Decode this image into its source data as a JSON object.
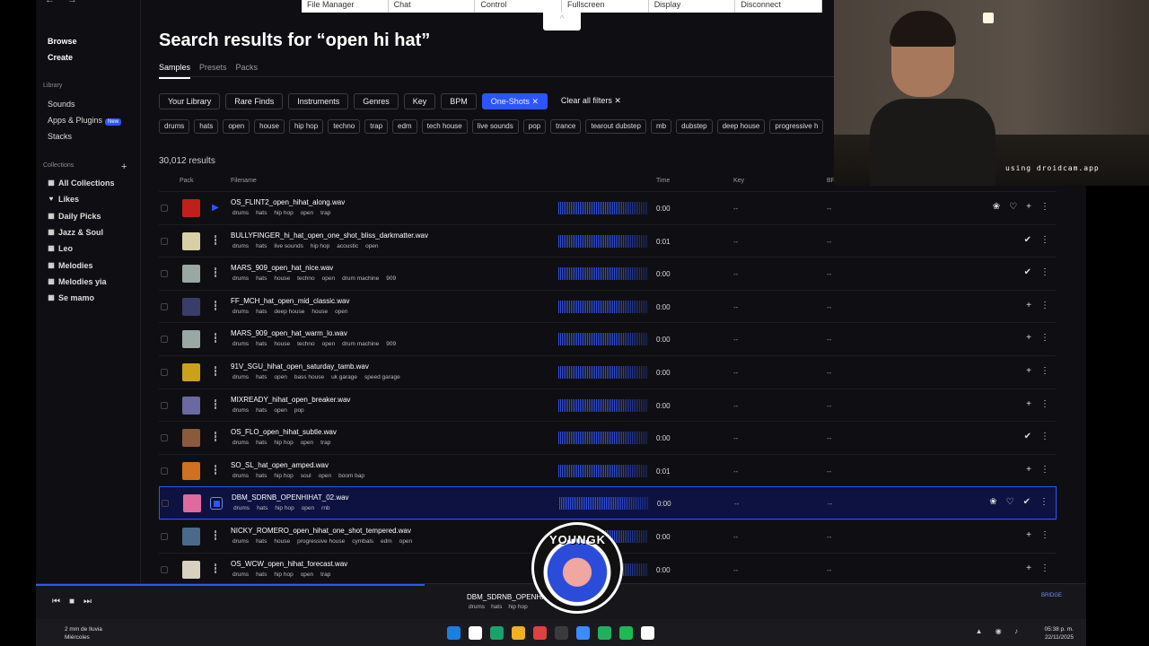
{
  "remote_bar": {
    "items": [
      "File Manager",
      "Chat",
      "Control",
      "Fullscreen",
      "Display",
      "Disconnect"
    ],
    "tab_glyph": "^"
  },
  "app": {
    "top_label": "Companion",
    "nav_main": [
      "Browse",
      "Create"
    ],
    "library_label": "Library",
    "nav_library": [
      {
        "label": "Sounds",
        "badge": ""
      },
      {
        "label": "Apps & Plugins",
        "badge": "New"
      },
      {
        "label": "Stacks",
        "badge": ""
      }
    ],
    "collections_label": "Collections",
    "add_collection": "+",
    "collections": [
      "All Collections",
      "Likes",
      "Daily Picks",
      "Jazz & Soul",
      "Leo",
      "Melodies",
      "Melodies yia",
      "Se mamo"
    ]
  },
  "search": {
    "title": "Search results for “open hi hat”",
    "tabs": [
      "Samples",
      "Presets",
      "Packs"
    ],
    "filters": [
      {
        "label": "Your Library",
        "style": "outline"
      },
      {
        "label": "Rare Finds",
        "style": "outline"
      },
      {
        "label": "Instruments",
        "style": "outline"
      },
      {
        "label": "Genres",
        "style": "outline"
      },
      {
        "label": "Key",
        "style": "outline"
      },
      {
        "label": "BPM",
        "style": "outline"
      },
      {
        "label": "One-Shots ✕",
        "style": "blue"
      },
      {
        "label": "Clear all filters ✕",
        "style": "plain"
      }
    ],
    "tag_chips": [
      "drums",
      "hats",
      "open",
      "house",
      "hip hop",
      "techno",
      "trap",
      "edm",
      "tech house",
      "live sounds",
      "pop",
      "trance",
      "tearout dubstep",
      "mb",
      "dubstep",
      "deep house",
      "progressive h"
    ],
    "results_count": "30,012 results",
    "columns": {
      "pack": "Pack",
      "filename": "Filename",
      "time": "Time",
      "key": "Key",
      "bpm": "BP"
    }
  },
  "rows": [
    {
      "file": "OS_FLINT2_open_hihat_along.wav",
      "tags": [
        "drums",
        "hats",
        "hip hop",
        "open",
        "trap"
      ],
      "time": "0:00",
      "key": "--",
      "bpm": "--",
      "art": "#c0201c",
      "state": "playing",
      "acts": [
        "❀",
        "♡",
        "+",
        "⋮"
      ]
    },
    {
      "file": "BULLYFINGER_hi_hat_open_one_shot_bliss_darkmatter.wav",
      "tags": [
        "drums",
        "hats",
        "live sounds",
        "hip hop",
        "acoustic",
        "open"
      ],
      "time": "0:01",
      "key": "--",
      "bpm": "--",
      "art": "#d8cfa6",
      "state": "",
      "acts": [
        "✔",
        "⋮"
      ]
    },
    {
      "file": "MARS_909_open_hat_nice.wav",
      "tags": [
        "drums",
        "hats",
        "house",
        "techno",
        "open",
        "drum machine",
        "909"
      ],
      "time": "0:00",
      "key": "--",
      "bpm": "--",
      "art": "#9aa8a4",
      "state": "",
      "acts": [
        "✔",
        "⋮"
      ]
    },
    {
      "file": "FF_MCH_hat_open_mid_classic.wav",
      "tags": [
        "drums",
        "hats",
        "deep house",
        "house",
        "open"
      ],
      "time": "0:00",
      "key": "--",
      "bpm": "--",
      "art": "#3a3c6a",
      "state": "",
      "acts": [
        "+",
        "⋮"
      ]
    },
    {
      "file": "MARS_909_open_hat_warm_lo.wav",
      "tags": [
        "drums",
        "hats",
        "house",
        "techno",
        "open",
        "drum machine",
        "909"
      ],
      "time": "0:00",
      "key": "--",
      "bpm": "--",
      "art": "#9aa8a4",
      "state": "",
      "acts": [
        "+",
        "⋮"
      ]
    },
    {
      "file": "91V_SGU_hihat_open_saturday_tamb.wav",
      "tags": [
        "drums",
        "hats",
        "open",
        "bass house",
        "uk garage",
        "speed garage"
      ],
      "time": "0:00",
      "key": "--",
      "bpm": "--",
      "art": "#c9a21a",
      "state": "",
      "acts": [
        "+",
        "⋮"
      ]
    },
    {
      "file": "MIXREADY_hihat_open_breaker.wav",
      "tags": [
        "drums",
        "hats",
        "open",
        "pop"
      ],
      "time": "0:00",
      "key": "--",
      "bpm": "--",
      "art": "#6a6aa0",
      "state": "",
      "acts": [
        "+",
        "⋮"
      ]
    },
    {
      "file": "OS_FLO_open_hihat_subtle.wav",
      "tags": [
        "drums",
        "hats",
        "hip hop",
        "open",
        "trap"
      ],
      "time": "0:00",
      "key": "--",
      "bpm": "--",
      "art": "#8a5a3a",
      "state": "",
      "acts": [
        "✔",
        "⋮"
      ]
    },
    {
      "file": "SO_SL_hat_open_amped.wav",
      "tags": [
        "drums",
        "hats",
        "hip hop",
        "soul",
        "open",
        "boom bap"
      ],
      "time": "0:01",
      "key": "--",
      "bpm": "--",
      "art": "#d07020",
      "state": "",
      "acts": [
        "+",
        "⋮"
      ]
    },
    {
      "file": "DBM_SDRNB_OPENHIHAT_02.wav",
      "tags": [
        "drums",
        "hats",
        "hip hop",
        "open",
        "rnb"
      ],
      "time": "0:00",
      "key": "--",
      "bpm": "--",
      "art": "#e06aa0",
      "state": "selected",
      "acts": [
        "❀",
        "♡",
        "✔",
        "⋮"
      ]
    },
    {
      "file": "NICKY_ROMERO_open_hihat_one_shot_tempered.wav",
      "tags": [
        "drums",
        "hats",
        "house",
        "progressive house",
        "cymbals",
        "edm",
        "open"
      ],
      "time": "0:00",
      "key": "--",
      "bpm": "--",
      "art": "#4a6a8a",
      "state": "",
      "acts": [
        "+",
        "⋮"
      ]
    },
    {
      "file": "OS_WCW_open_hihat_forecast.wav",
      "tags": [
        "drums",
        "hats",
        "hip hop",
        "open",
        "trap"
      ],
      "time": "0:00",
      "key": "--",
      "bpm": "--",
      "art": "#d8d0c0",
      "state": "",
      "acts": [
        "+",
        "⋮"
      ]
    }
  ],
  "player": {
    "now_playing": "DBM_SDRNB_OPENHIHAT_02.wav",
    "tags": [
      "drums",
      "hats",
      "hip hop"
    ],
    "progress": 0.37,
    "bridge_label": "BRIDGE",
    "controls": [
      "⏮",
      "■",
      "⏭"
    ]
  },
  "overlay": {
    "cam_text": "using droidcam.app",
    "logo_text": "YOUNGK"
  },
  "taskbar": {
    "weather_line1": "2 mm de lluvia",
    "weather_line2": "Miércoles",
    "time": "05:38 p. m.",
    "date": "22/11/2025",
    "tray": "▲ ◉ ♪",
    "icon_colors": [
      "#1a7fe0",
      "#ffffff",
      "#1aa26a",
      "#f0b020",
      "#e04040",
      "#3a3a40",
      "#3a8cff",
      "#22b060",
      "#1db954",
      "#ffffff"
    ]
  }
}
